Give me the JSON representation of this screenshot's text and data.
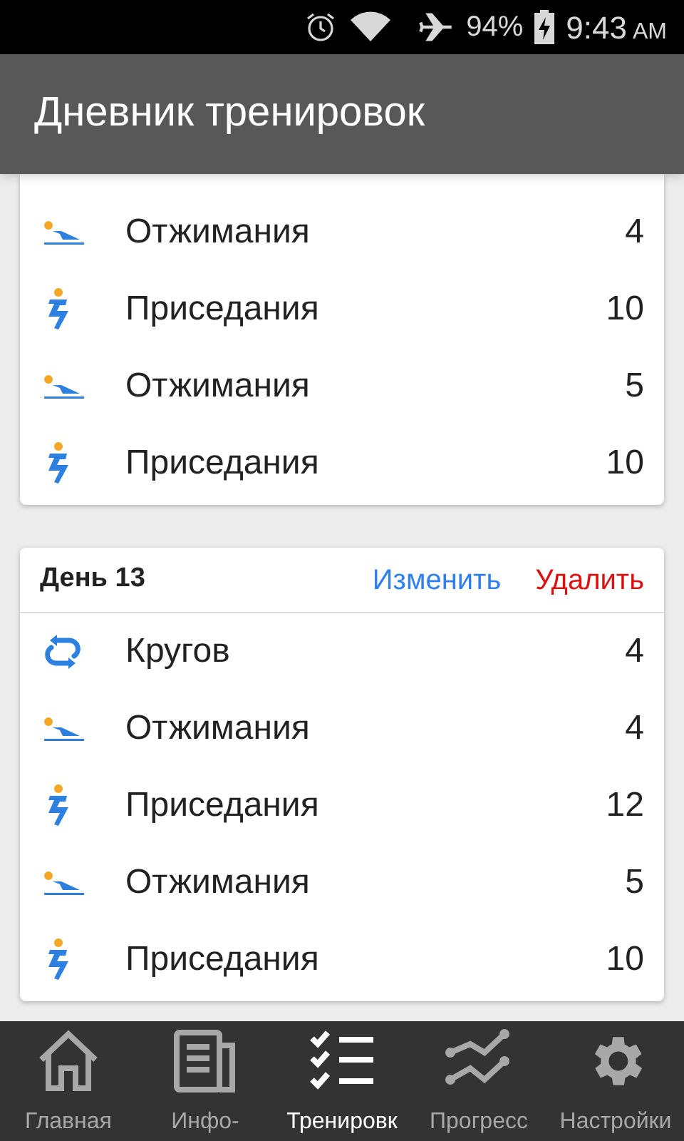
{
  "status_bar": {
    "battery": "94%",
    "time": "9:43",
    "ampm": "AM"
  },
  "app_bar": {
    "title": "Дневник тренировок"
  },
  "cards": [
    {
      "exercises": [
        {
          "kind": "pushup",
          "name": "Отжимания",
          "count": "4"
        },
        {
          "kind": "squat",
          "name": "Приседания",
          "count": "10"
        },
        {
          "kind": "pushup",
          "name": "Отжимания",
          "count": "5"
        },
        {
          "kind": "squat",
          "name": "Приседания",
          "count": "10"
        }
      ]
    },
    {
      "title": "День 13",
      "actions": [
        {
          "kind": "edit",
          "label": "Изменить"
        },
        {
          "kind": "delete",
          "label": "Удалить"
        }
      ],
      "exercises": [
        {
          "kind": "rounds",
          "name": "Кругов",
          "count": "4"
        },
        {
          "kind": "pushup",
          "name": "Отжимания",
          "count": "4"
        },
        {
          "kind": "squat",
          "name": "Приседания",
          "count": "12"
        },
        {
          "kind": "pushup",
          "name": "Отжимания",
          "count": "5"
        },
        {
          "kind": "squat",
          "name": "Приседания",
          "count": "10"
        }
      ]
    }
  ],
  "bottom_nav": [
    {
      "kind": "home",
      "label": "Главная",
      "selected": false
    },
    {
      "kind": "news",
      "label": "Инфо-",
      "selected": false
    },
    {
      "kind": "checklist",
      "label": "Тренировк",
      "selected": true
    },
    {
      "kind": "progress",
      "label": "Прогресс",
      "selected": false
    },
    {
      "kind": "settings",
      "label": "Настройки",
      "selected": false
    }
  ]
}
